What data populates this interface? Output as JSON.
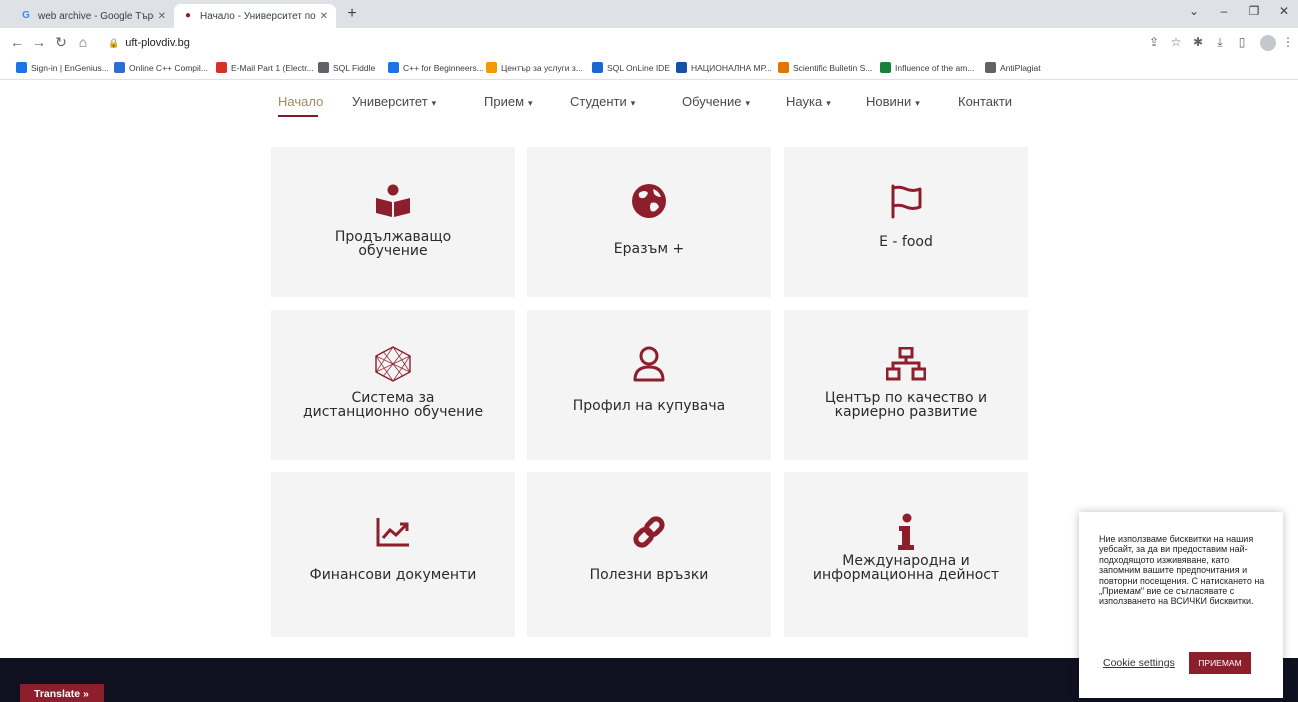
{
  "browser": {
    "tabs": [
      {
        "title": "web archive - Google Търсене",
        "favicon": "G"
      },
      {
        "title": "Начало - Университет по хран...",
        "favicon": "●"
      }
    ],
    "new_tab_icon": "+",
    "window_controls": [
      "⌄",
      "–",
      "❐",
      "✕"
    ],
    "url": "uft-plovdiv.bg",
    "bookmarks": [
      {
        "label": "Sign-in | EnGenius...",
        "color": "#1a73e8"
      },
      {
        "label": "Online C++ Compil...",
        "color": "#2f6fd1"
      },
      {
        "label": "E-Mail Part 1 (Electr...",
        "color": "#d93025"
      },
      {
        "label": "SQL Fiddle",
        "color": "#5f6368"
      },
      {
        "label": "C++ for Beginneers...",
        "color": "#1a73e8"
      },
      {
        "label": "Център за услуги з...",
        "color": "#f29900"
      },
      {
        "label": "SQL OnLine IDE",
        "color": "#1967d2"
      },
      {
        "label": "НАЦИОНАЛНА МР...",
        "color": "#174ea6"
      },
      {
        "label": "Scientific Bulletin S...",
        "color": "#e37400"
      },
      {
        "label": "Influence of the am...",
        "color": "#188038"
      },
      {
        "label": "AntiPlagiat",
        "color": "#5f6368"
      }
    ]
  },
  "nav": {
    "items": [
      {
        "label": "Начало",
        "dropdown": false,
        "active": true
      },
      {
        "label": "Университет",
        "dropdown": true
      },
      {
        "label": "Прием",
        "dropdown": true
      },
      {
        "label": "Студенти",
        "dropdown": true
      },
      {
        "label": "Обучение",
        "dropdown": true
      },
      {
        "label": "Наука",
        "dropdown": true
      },
      {
        "label": "Новини",
        "dropdown": true
      },
      {
        "label": "Контакти",
        "dropdown": false
      }
    ],
    "caret": "▾"
  },
  "cards": [
    {
      "label": "Продължаващо обучение",
      "icon": "reader-book-icon"
    },
    {
      "label": "Еразъм +",
      "icon": "globe-icon"
    },
    {
      "label": "E - food",
      "icon": "flag-icon"
    },
    {
      "label": "Система за дистанционно обучение",
      "icon": "hexagon-mesh-icon"
    },
    {
      "label": "Профил на купувача",
      "icon": "user-icon"
    },
    {
      "label": "Център по качество и кариерно развитие",
      "icon": "sitemap-icon"
    },
    {
      "label": "Финансови документи",
      "icon": "chart-line-icon"
    },
    {
      "label": "Полезни връзки",
      "icon": "link-icon"
    },
    {
      "label": "Международна и информационна дейност",
      "icon": "info-icon"
    }
  ],
  "colors": {
    "accent": "#8d1f2d",
    "footer": "#0f1121",
    "card_bg": "#f5f4f4"
  },
  "translate": {
    "label": "Translate »"
  },
  "cookie": {
    "text": "Ние използваме бисквитки на нашия уебсайт, за да ви предоставим най-подходящото изживяване, като запомним вашите предпочитания и повторни посещения. С натискането на „Приемам\" вие се съгласявате с използването на ВСИЧКИ бисквитки.",
    "settings_label": "Cookie settings",
    "accept_label": "ПРИЕМАМ"
  }
}
